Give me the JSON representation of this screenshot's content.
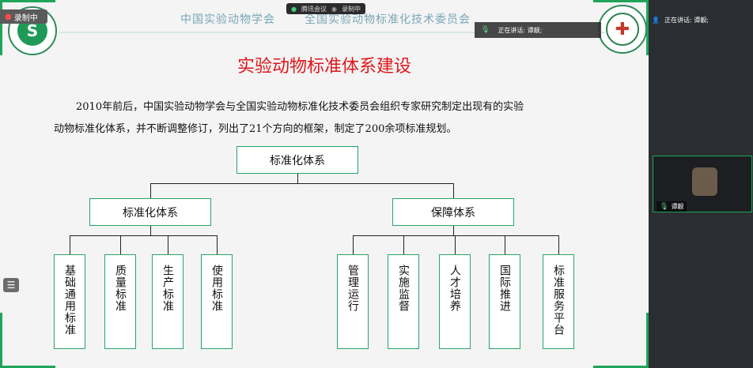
{
  "meeting": {
    "record_tag": "录制中",
    "top_status": [
      "腾讯会议",
      "录制中"
    ],
    "speaking_label": "正在讲话: 谭靓;",
    "panel_speaking": "正在讲话: 谭靓;",
    "participant_name": "谭靓"
  },
  "slide": {
    "header_left": "中国实验动物学会",
    "header_right": "全国实验动物标准化技术委员会",
    "title": "实验动物标准体系建设",
    "para_line1": "2010年前后，中国实验动物学会与全国实验动物标准化技术委员会组织专家研究制定出现有的实验",
    "para_line2": "动物标准化体系，并不断调整修订，列出了21个方向的框架，制定了200余项标准规划。",
    "root": "标准化体系",
    "branch_left": "标准化体系",
    "branch_right": "保障体系",
    "leaves_left": [
      "基础通用标准",
      "质量标准",
      "生产标准",
      "使用标准"
    ],
    "leaves_right": [
      "管理运行",
      "实施监督",
      "人才培养",
      "国际推进",
      "标准服务平台"
    ]
  },
  "colors": {
    "accent": "#1fa55a",
    "title": "#e0161b",
    "box_border": "#2aa36a"
  }
}
